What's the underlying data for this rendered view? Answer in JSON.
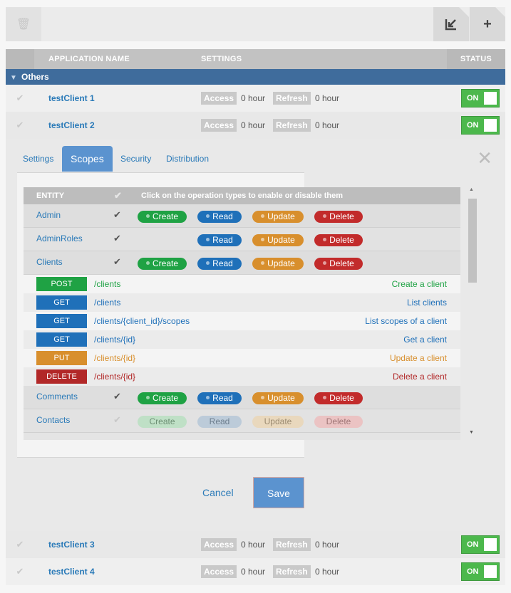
{
  "toolbar": {
    "trash_icon": "trash-icon",
    "export_icon": "import-export-icon",
    "add_icon": "plus-icon"
  },
  "table_header": {
    "name": "APPLICATION NAME",
    "settings": "SETTINGS",
    "status": "STATUS"
  },
  "group": {
    "name": "Others"
  },
  "clients": [
    {
      "name": "testClient 1",
      "access_label": "Access",
      "access_value": "0 hour",
      "refresh_label": "Refresh",
      "refresh_value": "0 hour",
      "status": "ON"
    },
    {
      "name": "testClient 2",
      "access_label": "Access",
      "access_value": "0 hour",
      "refresh_label": "Refresh",
      "refresh_value": "0 hour",
      "status": "ON"
    },
    {
      "name": "testClient 3",
      "access_label": "Access",
      "access_value": "0 hour",
      "refresh_label": "Refresh",
      "refresh_value": "0 hour",
      "status": "ON"
    },
    {
      "name": "testClient 4",
      "access_label": "Access",
      "access_value": "0 hour",
      "refresh_label": "Refresh",
      "refresh_value": "0 hour",
      "status": "ON"
    }
  ],
  "panel": {
    "tabs": [
      {
        "label": "Settings"
      },
      {
        "label": "Scopes",
        "active": true
      },
      {
        "label": "Security"
      },
      {
        "label": "Distribution"
      }
    ],
    "close_glyph": "✕",
    "cancel_label": "Cancel",
    "save_label": "Save"
  },
  "scopes": {
    "header_entity": "ENTITY",
    "header_hint": "Click on the operation types to enable or disable them",
    "operations": {
      "create": "Create",
      "read": "Read",
      "update": "Update",
      "delete": "Delete"
    },
    "entities": [
      {
        "name": "Admin"
      },
      {
        "name": "AdminRoles"
      },
      {
        "name": "Clients"
      },
      {
        "name": "Comments"
      },
      {
        "name": "Contacts"
      }
    ],
    "client_methods": [
      {
        "method": "POST",
        "path": "/clients",
        "description": "Create a client",
        "color": "#1fa244"
      },
      {
        "method": "GET",
        "path": "/clients",
        "description": "List clients",
        "color": "#1f70b9"
      },
      {
        "method": "GET",
        "path": "/clients/{client_id}/scopes",
        "description": "List scopes of a client",
        "color": "#1f70b9"
      },
      {
        "method": "GET",
        "path": "/clients/{id}",
        "description": "Get a client",
        "color": "#1f70b9"
      },
      {
        "method": "PUT",
        "path": "/clients/{id}",
        "description": "Update a client",
        "color": "#d88f2d"
      },
      {
        "method": "DELETE",
        "path": "/clients/{id}",
        "description": "Delete a client",
        "color": "#b22828"
      }
    ]
  },
  "colors": {
    "accent": "#5b93cf",
    "group_bar": "#3f6c9c",
    "toggle_on": "#4cb84c",
    "create": "#1fa244",
    "read": "#1f70b9",
    "update": "#d88f2d",
    "delete": "#c22b2b"
  }
}
